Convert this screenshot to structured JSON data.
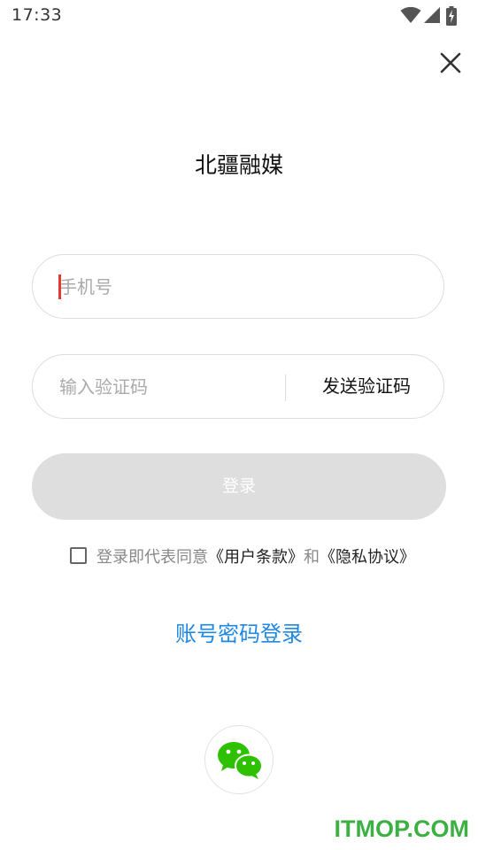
{
  "status_bar": {
    "time": "17:33",
    "icons": [
      "wifi-icon",
      "cellular-signal-icon",
      "battery-charging-icon"
    ]
  },
  "header": {
    "close_icon": "close-icon",
    "title": "北疆融媒"
  },
  "form": {
    "phone": {
      "placeholder": "手机号",
      "value": ""
    },
    "code": {
      "placeholder": "输入验证码",
      "value": "",
      "send_label": "发送验证码"
    },
    "login_label": "登录"
  },
  "agreement": {
    "checked": false,
    "prefix": "登录即代表同意",
    "terms_link": "《用户条款》",
    "and": "和",
    "privacy_link": "《隐私协议》"
  },
  "alt_login": {
    "account_login_label": "账号密码登录",
    "wechat_icon": "wechat-icon"
  },
  "watermark": "ITMOP.COM",
  "colors": {
    "accent_blue": "#1e88e5",
    "button_disabled": "#dedede",
    "wechat_green": "#2dc100",
    "caret_red": "#e53935",
    "watermark_green": "#3cb043"
  }
}
